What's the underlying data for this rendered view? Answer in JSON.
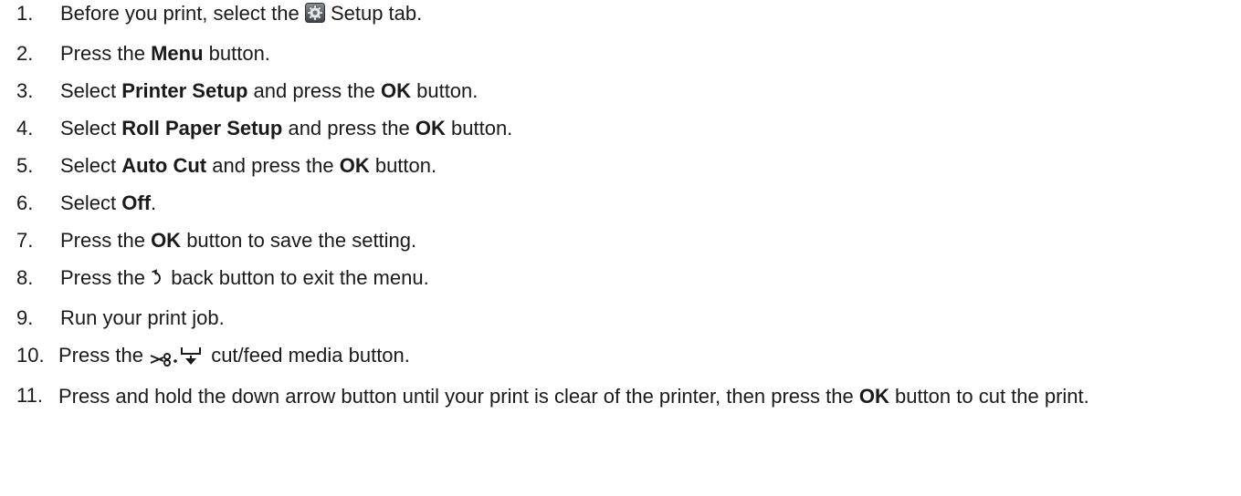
{
  "steps": [
    {
      "num": "1.",
      "a": "Before you print, select the",
      "icon": "setup-gear-icon",
      "b": "Setup tab."
    },
    {
      "num": "2.",
      "a": "Press the",
      "bold1": "Menu",
      "b": "button."
    },
    {
      "num": "3.",
      "a": "Select",
      "bold1": "Printer Setup",
      "b": "and press the",
      "bold2": "OK",
      "c": "button."
    },
    {
      "num": "4.",
      "a": "Select",
      "bold1": "Roll Paper Setup",
      "b": "and press the",
      "bold2": "OK",
      "c": "button."
    },
    {
      "num": "5.",
      "a": "Select",
      "bold1": "Auto Cut",
      "b": "and press the",
      "bold2": "OK",
      "c": "button."
    },
    {
      "num": "6.",
      "a": "Select",
      "bold1": "Off",
      "b": "."
    },
    {
      "num": "7.",
      "a": "Press the",
      "bold1": "OK",
      "b": "button to save the setting."
    },
    {
      "num": "8.",
      "a": "Press the",
      "icon": "back-arrow-icon",
      "b": "back button to exit the menu."
    },
    {
      "num": "9.",
      "a": "Run your print job."
    },
    {
      "num": "10.",
      "a": "Press the",
      "icon": "cut-feed-icon",
      "b": "cut/feed media button."
    },
    {
      "num": "11.",
      "a": "Press and hold the down arrow button until your print is clear of the printer, then press the",
      "bold1": "OK",
      "b": "button to cut the print."
    }
  ]
}
